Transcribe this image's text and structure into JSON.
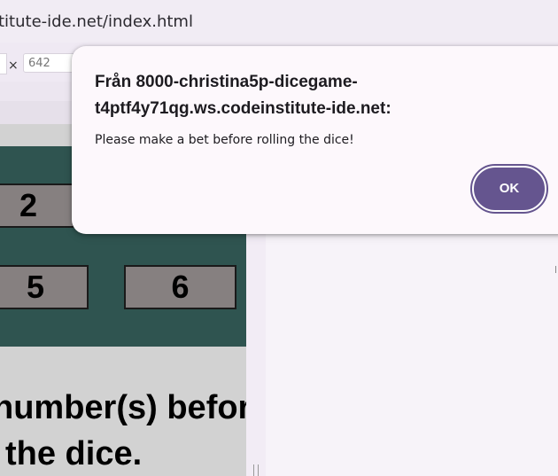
{
  "browser": {
    "url_fragment": "titute-ide.net/index.html"
  },
  "devtools": {
    "close_symbol": "×",
    "height_value": "642"
  },
  "game": {
    "dice_row1": [
      "2"
    ],
    "dice_row2": [
      "5",
      "6"
    ],
    "instruction_line1": "number(s) before",
    "instruction_line2": "the dice."
  },
  "dialog": {
    "title": "Från 8000-christina5p-dicegame-t4ptf4y71qg.ws.codeinstitute-ide.net:",
    "message": "Please make a bet before rolling the dice!",
    "ok_label": "OK"
  },
  "colors": {
    "game_panel": "#2f5450",
    "die_face": "#868080",
    "ok_button": "#65558f",
    "dialog_bg": "#fdf8fc"
  }
}
